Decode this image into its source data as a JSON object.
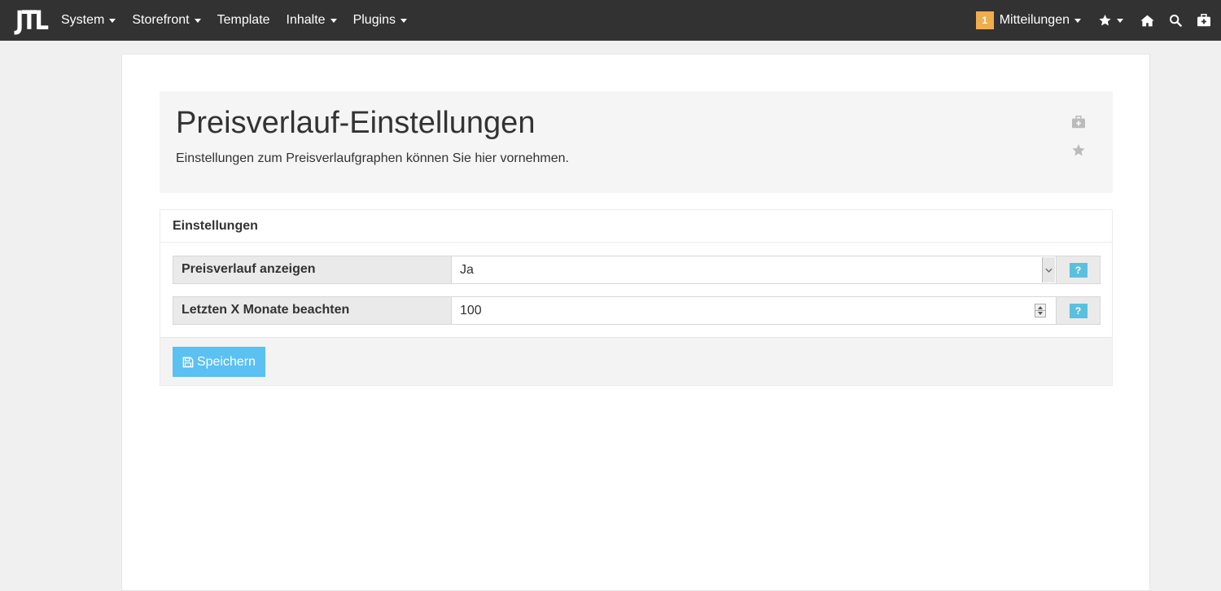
{
  "navbar": {
    "logo": "JTL",
    "menu": [
      {
        "label": "System",
        "has_caret": true
      },
      {
        "label": "Storefront",
        "has_caret": true
      },
      {
        "label": "Template",
        "has_caret": false
      },
      {
        "label": "Inhalte",
        "has_caret": true
      },
      {
        "label": "Plugins",
        "has_caret": true
      }
    ],
    "notifications": {
      "count": "1",
      "label": "Mitteilungen"
    },
    "icons": [
      "star-icon",
      "home-icon",
      "search-icon",
      "first-aid-icon"
    ]
  },
  "header": {
    "title": "Preisverlauf-Einstellungen",
    "description": "Einstellungen zum Preisverlaufgraphen können Sie hier vornehmen."
  },
  "settings": {
    "title": "Einstellungen",
    "rows": [
      {
        "label": "Preisverlauf anzeigen",
        "value": "Ja",
        "type": "select",
        "help": "?"
      },
      {
        "label": "Letzten X Monate beachten",
        "value": "100",
        "type": "number",
        "help": "?"
      }
    ],
    "save_label": "Speichern"
  },
  "colors": {
    "navbar_bg": "#323232",
    "badge": "#f0ad4e",
    "help_button": "#5bc0de",
    "save_button": "#5bc0f2"
  }
}
